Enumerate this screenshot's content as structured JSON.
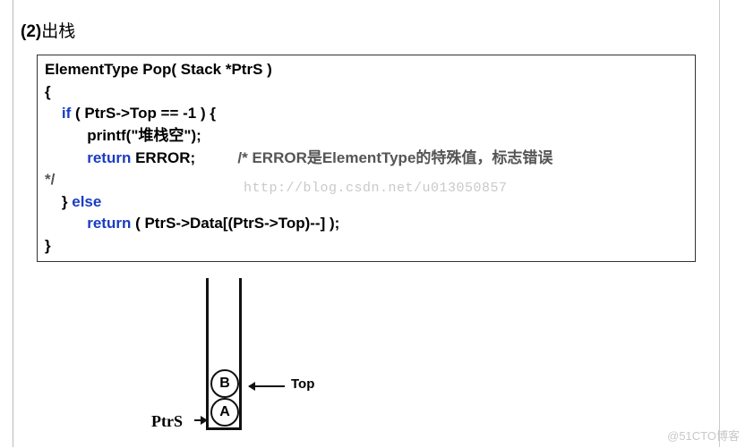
{
  "heading": {
    "num": "(2)",
    "text": "出栈"
  },
  "code": {
    "sig": "ElementType Pop( Stack *PtrS )",
    "open": "{",
    "if_kw": "if",
    "if_cond": " ( PtrS->Top == -1 ) {",
    "printf": "printf(\"堆栈空\");",
    "return_kw": "return",
    "error_tok": " ERROR",
    "semicolon": ";",
    "comment_open": "/* ERROR是ElementType的特殊值，标志错误",
    "comment_close": "*/",
    "close_if": "} ",
    "else_kw": "else",
    "return2_kw": "return",
    "return2_expr": " ( PtrS->Data[(PtrS->Top)--] );",
    "close": "}"
  },
  "watermark_code": "http://blog.csdn.net/u013050857",
  "diagram": {
    "cell_b": "B",
    "cell_a": "A",
    "ptrs": "PtrS",
    "top": "Top"
  },
  "corner_watermark": "@51CTO博客"
}
